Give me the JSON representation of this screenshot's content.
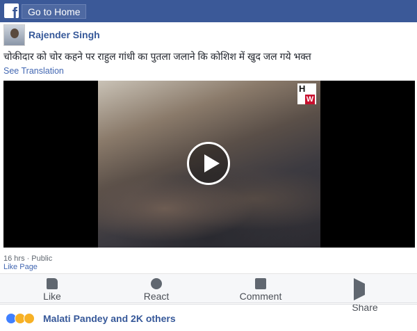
{
  "topbar": {
    "home_label": "Go to Home",
    "logo_letter": "f",
    "brand_color": "#3b5998"
  },
  "post": {
    "author": "Rajender Singh",
    "text": "चोकीदार को चोर कहने पर राहुल गांधी का पुतला जलाने कि कोशिश में खुद जल गये भक्त",
    "see_translation": "See Translation",
    "time": "16 hrs",
    "privacy": "Public",
    "like_page": "Like Page"
  },
  "video": {
    "watermark_top": "H",
    "watermark_bottom": "W"
  },
  "actions": [
    {
      "label": "Like",
      "icon": "thumbs-up-icon"
    },
    {
      "label": "React",
      "icon": "smiley-icon"
    },
    {
      "label": "Comment",
      "icon": "comment-icon"
    },
    {
      "label": "Share",
      "icon": "share-icon"
    }
  ],
  "reactions": {
    "summary": "Malati Pandey and 2K others",
    "icons": [
      "like-reaction-icon",
      "haha-reaction-icon",
      "sad-reaction-icon"
    ]
  }
}
